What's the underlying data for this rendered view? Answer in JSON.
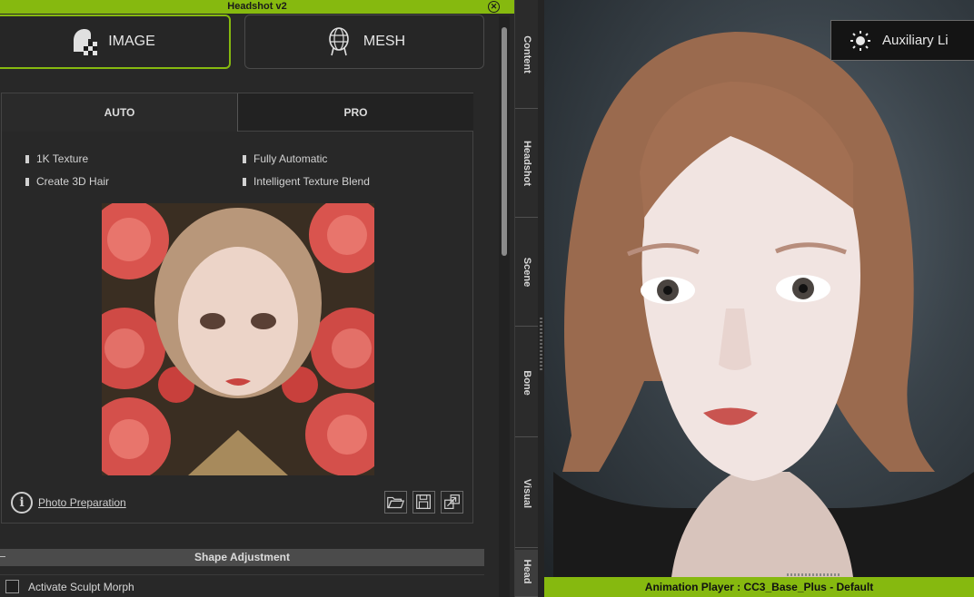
{
  "window": {
    "title": "Headshot v2"
  },
  "mode_buttons": {
    "image": "IMAGE",
    "mesh": "MESH"
  },
  "tabs": {
    "auto": "AUTO",
    "pro": "PRO"
  },
  "features": [
    "1K Texture",
    "Fully Automatic",
    "Create 3D Hair",
    "Intelligent Texture Blend"
  ],
  "photo_preparation": "Photo Preparation",
  "shape_adjustment": {
    "header": "Shape Adjustment",
    "activate_sculpt_morph": "Activate Sculpt Morph"
  },
  "side_tabs": [
    "Content",
    "Headshot",
    "Scene",
    "Bone",
    "Visual",
    "Head"
  ],
  "viewport": {
    "aux_button": "Auxiliary Li"
  },
  "animation_player": "Animation Player : CC3_Base_Plus - Default",
  "colors": {
    "accent": "#86b90f",
    "panel": "#282828"
  },
  "icons": [
    "close-icon",
    "image-mode-icon",
    "mesh-mode-icon",
    "info-icon",
    "folder-open-icon",
    "save-icon",
    "export-icon",
    "sun-icon"
  ]
}
